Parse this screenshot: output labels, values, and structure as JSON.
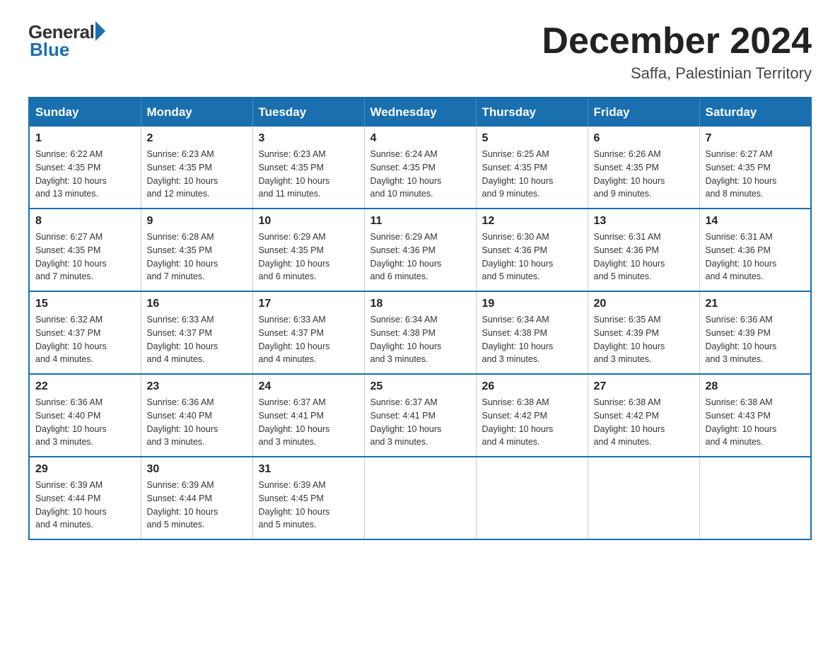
{
  "logo": {
    "general": "General",
    "blue": "Blue"
  },
  "header": {
    "month_year": "December 2024",
    "location": "Saffa, Palestinian Territory"
  },
  "weekdays": [
    "Sunday",
    "Monday",
    "Tuesday",
    "Wednesday",
    "Thursday",
    "Friday",
    "Saturday"
  ],
  "weeks": [
    [
      {
        "day": "1",
        "sunrise": "6:22 AM",
        "sunset": "4:35 PM",
        "daylight": "10 hours and 13 minutes."
      },
      {
        "day": "2",
        "sunrise": "6:23 AM",
        "sunset": "4:35 PM",
        "daylight": "10 hours and 12 minutes."
      },
      {
        "day": "3",
        "sunrise": "6:23 AM",
        "sunset": "4:35 PM",
        "daylight": "10 hours and 11 minutes."
      },
      {
        "day": "4",
        "sunrise": "6:24 AM",
        "sunset": "4:35 PM",
        "daylight": "10 hours and 10 minutes."
      },
      {
        "day": "5",
        "sunrise": "6:25 AM",
        "sunset": "4:35 PM",
        "daylight": "10 hours and 9 minutes."
      },
      {
        "day": "6",
        "sunrise": "6:26 AM",
        "sunset": "4:35 PM",
        "daylight": "10 hours and 9 minutes."
      },
      {
        "day": "7",
        "sunrise": "6:27 AM",
        "sunset": "4:35 PM",
        "daylight": "10 hours and 8 minutes."
      }
    ],
    [
      {
        "day": "8",
        "sunrise": "6:27 AM",
        "sunset": "4:35 PM",
        "daylight": "10 hours and 7 minutes."
      },
      {
        "day": "9",
        "sunrise": "6:28 AM",
        "sunset": "4:35 PM",
        "daylight": "10 hours and 7 minutes."
      },
      {
        "day": "10",
        "sunrise": "6:29 AM",
        "sunset": "4:35 PM",
        "daylight": "10 hours and 6 minutes."
      },
      {
        "day": "11",
        "sunrise": "6:29 AM",
        "sunset": "4:36 PM",
        "daylight": "10 hours and 6 minutes."
      },
      {
        "day": "12",
        "sunrise": "6:30 AM",
        "sunset": "4:36 PM",
        "daylight": "10 hours and 5 minutes."
      },
      {
        "day": "13",
        "sunrise": "6:31 AM",
        "sunset": "4:36 PM",
        "daylight": "10 hours and 5 minutes."
      },
      {
        "day": "14",
        "sunrise": "6:31 AM",
        "sunset": "4:36 PM",
        "daylight": "10 hours and 4 minutes."
      }
    ],
    [
      {
        "day": "15",
        "sunrise": "6:32 AM",
        "sunset": "4:37 PM",
        "daylight": "10 hours and 4 minutes."
      },
      {
        "day": "16",
        "sunrise": "6:33 AM",
        "sunset": "4:37 PM",
        "daylight": "10 hours and 4 minutes."
      },
      {
        "day": "17",
        "sunrise": "6:33 AM",
        "sunset": "4:37 PM",
        "daylight": "10 hours and 4 minutes."
      },
      {
        "day": "18",
        "sunrise": "6:34 AM",
        "sunset": "4:38 PM",
        "daylight": "10 hours and 3 minutes."
      },
      {
        "day": "19",
        "sunrise": "6:34 AM",
        "sunset": "4:38 PM",
        "daylight": "10 hours and 3 minutes."
      },
      {
        "day": "20",
        "sunrise": "6:35 AM",
        "sunset": "4:39 PM",
        "daylight": "10 hours and 3 minutes."
      },
      {
        "day": "21",
        "sunrise": "6:36 AM",
        "sunset": "4:39 PM",
        "daylight": "10 hours and 3 minutes."
      }
    ],
    [
      {
        "day": "22",
        "sunrise": "6:36 AM",
        "sunset": "4:40 PM",
        "daylight": "10 hours and 3 minutes."
      },
      {
        "day": "23",
        "sunrise": "6:36 AM",
        "sunset": "4:40 PM",
        "daylight": "10 hours and 3 minutes."
      },
      {
        "day": "24",
        "sunrise": "6:37 AM",
        "sunset": "4:41 PM",
        "daylight": "10 hours and 3 minutes."
      },
      {
        "day": "25",
        "sunrise": "6:37 AM",
        "sunset": "4:41 PM",
        "daylight": "10 hours and 3 minutes."
      },
      {
        "day": "26",
        "sunrise": "6:38 AM",
        "sunset": "4:42 PM",
        "daylight": "10 hours and 4 minutes."
      },
      {
        "day": "27",
        "sunrise": "6:38 AM",
        "sunset": "4:42 PM",
        "daylight": "10 hours and 4 minutes."
      },
      {
        "day": "28",
        "sunrise": "6:38 AM",
        "sunset": "4:43 PM",
        "daylight": "10 hours and 4 minutes."
      }
    ],
    [
      {
        "day": "29",
        "sunrise": "6:39 AM",
        "sunset": "4:44 PM",
        "daylight": "10 hours and 4 minutes."
      },
      {
        "day": "30",
        "sunrise": "6:39 AM",
        "sunset": "4:44 PM",
        "daylight": "10 hours and 5 minutes."
      },
      {
        "day": "31",
        "sunrise": "6:39 AM",
        "sunset": "4:45 PM",
        "daylight": "10 hours and 5 minutes."
      },
      null,
      null,
      null,
      null
    ]
  ],
  "labels": {
    "sunrise": "Sunrise:",
    "sunset": "Sunset:",
    "daylight": "Daylight:"
  }
}
